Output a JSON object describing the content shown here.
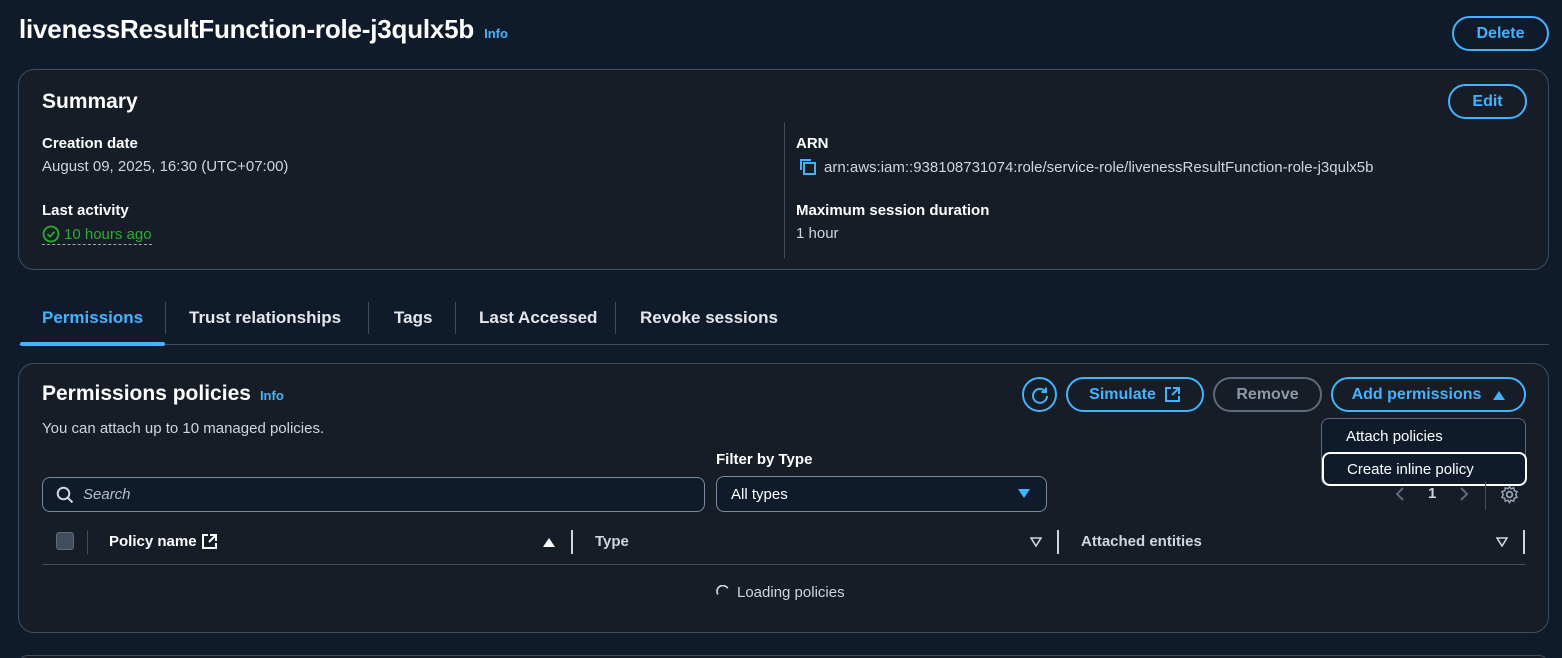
{
  "header": {
    "title": "livenessResultFunction-role-j3qulx5b",
    "info_label": "Info",
    "delete_label": "Delete"
  },
  "summary": {
    "title": "Summary",
    "edit_label": "Edit",
    "creation_date_label": "Creation date",
    "creation_date_value": "August 09, 2025, 16:30 (UTC+07:00)",
    "last_activity_label": "Last activity",
    "last_activity_value": "10 hours ago",
    "arn_label": "ARN",
    "arn_value": "arn:aws:iam::938108731074:role/service-role/livenessResultFunction-role-j3qulx5b",
    "max_session_label": "Maximum session duration",
    "max_session_value": "1 hour"
  },
  "tabs": [
    {
      "label": "Permissions",
      "active": true
    },
    {
      "label": "Trust relationships"
    },
    {
      "label": "Tags"
    },
    {
      "label": "Last Accessed"
    },
    {
      "label": "Revoke sessions"
    }
  ],
  "permissions": {
    "title": "Permissions policies",
    "info_label": "Info",
    "description": "You can attach up to 10 managed policies.",
    "simulate_label": "Simulate",
    "remove_label": "Remove",
    "add_permissions_label": "Add permissions",
    "menu": [
      "Attach policies",
      "Create inline policy"
    ],
    "filter_label": "Filter by Type",
    "filter_value": "All types",
    "search_placeholder": "Search",
    "page_number": "1",
    "columns": {
      "policy_name": "Policy name",
      "type": "Type",
      "attached_entities": "Attached entities"
    },
    "loading_text": "Loading policies"
  },
  "colors": {
    "accent": "#42b4ff",
    "success": "#29ad32",
    "background": "#0f1b2a",
    "panel": "#161d26"
  }
}
